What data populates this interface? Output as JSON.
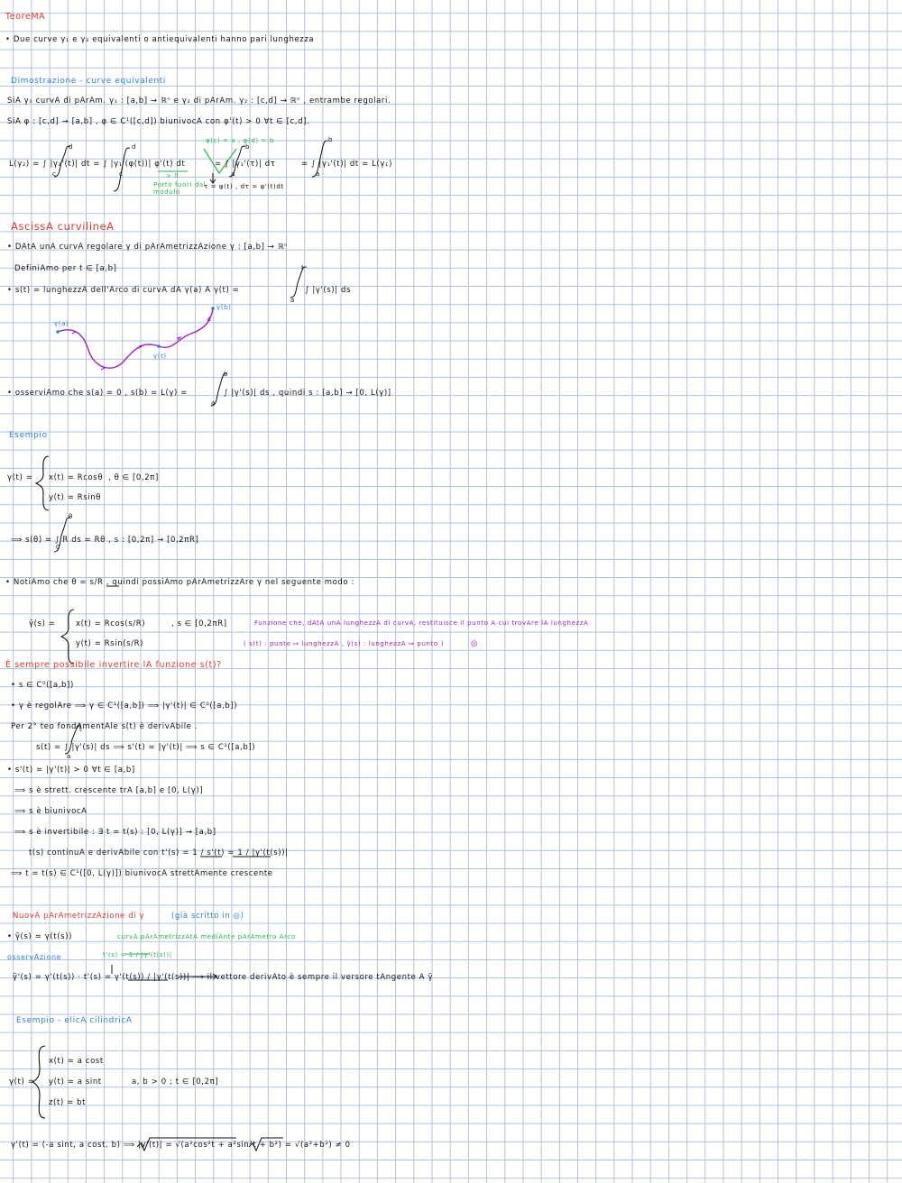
{
  "sec_teorema": {
    "title": "TeoreMA",
    "stmt": "• Due curve γ₁ e γ₂ equivalenti o antiequivalenti hanno pari lunghezza"
  },
  "sec_dim": {
    "title": "Dimostrazione - curve equivalenti",
    "line1": "SiA γ₁ curvA di pArAm. γ₁ : [a,b] → ℝⁿ e γ₂ di pArAm. γ₂ : [c,d] → ℝⁿ , entrambe regolari.",
    "line2": "SiA φ : [c,d] → [a,b] , φ ∈ C¹([c,d]) biunivocA con φ'(t) > 0 ∀t ∈ [c,d].",
    "eq_lhs": "L(γ₂) = ∫ |γ₂'(t)| dt = ∫ |γ₁'(φ(t))| φ'(t) dt",
    "bound_c1": "c",
    "bound_d1": "d",
    "bound_c2": "c",
    "bound_d2": "d",
    "eq_mid": "= ∫ |γ₁'(τ)| dτ",
    "eq_rhs": "= ∫ |γ₁'(t)| dt = L(γ₁)",
    "bound_a1": "a",
    "bound_b1": "b",
    "bound_a2": "a",
    "bound_b2": "b",
    "note_top": "φ(c) = a , φ(d) = b",
    "note_gt0": "> 0",
    "note_fuori": "Porto fuori dal",
    "note_modulo": "modulo",
    "note_subst": "τ = φ(t) , dτ = φ'(t)dt"
  },
  "sec_ascissa": {
    "title": "AscissA curvilineA",
    "line1": "• DAtA unA curvA regolare γ di pArAmetrizzAzione γ : [a,b] → ℝⁿ",
    "line2": "DefiniAmo per t ∈ [a,b]",
    "line3": "• s(t) = lunghezzA dell'Arco di curvA dA γ(a) A γ(t) =",
    "line3_int": "∫ |γ'(s)| ds",
    "int_top": "t",
    "int_bot": "a",
    "lbl_a": "γ(a)",
    "lbl_t": "γ(t)",
    "lbl_b": "γ(b)",
    "line4": "• osserviAmo che s(a) = 0 , s(b) = L(γ) =",
    "line4_int": "∫ |γ'(s)| ds , quindi s : [a,b] → [0, L(γ)]",
    "int2_top": "b",
    "int2_bot": "a"
  },
  "sec_esempio": {
    "title": "Esempio",
    "gamma_lhs": "γ(t) =",
    "x_eq": "x(t) = Rcosθ",
    "y_eq": "y(t) = Rsinθ",
    "domain": ", θ ∈ [0,2π]",
    "s_eq": "⟹ s(θ) = ∫ R ds = Rθ , s : [0,2π] → [0,2πR]",
    "s_top": "θ",
    "s_bot": "0",
    "notiamo": "• NotiAmo che θ = s/R , quindi possiAmo pArAmetrizzAre γ nel seguente modo :",
    "gt_lhs": "γ̃(s) =",
    "gt_x": "x(t) = Rcos(s/R)",
    "gt_y": "y(t) = Rsin(s/R)",
    "gt_domain": ", s ∈ [0,2πR]",
    "purple1": "Funzione che, dAtA unA lunghezzA di curvA, restituisce il punto A cui trovAre lA lunghezzA",
    "purple2": "( s(t) : punto ↦ lunghezzA , γ̃(s) : lunghezzA ↦ punto )",
    "purple_mark": "◎"
  },
  "sec_invert": {
    "title": "È sempre possibile invertire lA funzione s(t)?",
    "l1": "• s ∈ C⁰([a,b])",
    "l2": "• γ è regolAre ⟹ γ ∈ C¹([a,b]) ⟹ |γ'(t)| ∈ C⁰([a,b])",
    "l3": "Per 2° teo fondAmentAle s(t) è derivAbile .",
    "l4": "s(t) = ∫ |γ'(s)| ds ⟹ s'(t) = |γ'(t)| ⟹ s ∈ C¹([a,b])",
    "l4_top": "t",
    "l4_bot": "a",
    "l5": "• s'(t) = |γ'(t)| > 0 ∀t ∈ [a,b]",
    "l6": "⟹ s è strett. crescente trA [a,b] e [0, L(γ)]",
    "l7": "⟹ s è biunivocA",
    "l8": "⟹ s è invertibile : ∃ t = t(s) : [0, L(γ)] → [a,b]",
    "l9": "t(s) continuA e derivAbile con t'(s) = 1 / s'(t) = 1 / |γ'(t(s))|",
    "l10": "⟹ t = t(s) ∈ C¹([0, L(γ)]) biunivocA strettAmente crescente"
  },
  "sec_nuova": {
    "title": "NuovA pArAmetrizzAzione di γ",
    "title_note": "(già scritto in ◎)",
    "l1": "• γ̃(s) = γ(t(s))",
    "l1_note": "curvA pArAmetrizzAtA mediAnte pArAmetro Arco",
    "oss": "osservAzione",
    "green_note": "t'(s) = 1 / |γ'(t(s))|",
    "l2": "γ̃'(s) = γ'(t(s)) · t'(s) = γ'(t(s)) / |γ'(t(s))| ⟶ il vettore derivAto è sempre il versore tAngente A γ̃"
  },
  "sec_elica": {
    "title": "Esempio - elicA cilindricA",
    "lhs": "γ(t) =",
    "x": "x(t) = a cost",
    "y": "y(t) = a sint",
    "z": "z(t) = bt",
    "cond": "a, b > 0 ; t ∈ [0,2π]",
    "deriv": "γ'(t) = (-a sint, a cost, b) ⟹ |γ'(t)| = √(a²cos²t + a²sin²t + b²) = √(a²+b²) ≠ 0"
  },
  "colors": {
    "red": "#e2382c",
    "blue": "#2f7fd6",
    "green": "#2bb44b",
    "purple": "#a020c0",
    "grid": "#aec2db"
  }
}
